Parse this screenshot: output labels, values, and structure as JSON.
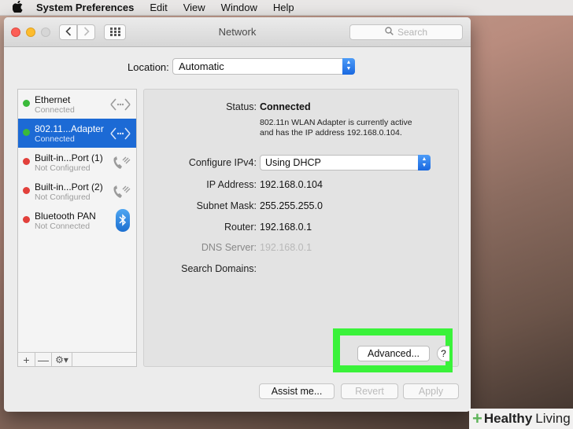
{
  "menubar": {
    "apple": "",
    "app": "System Preferences",
    "items": [
      "Edit",
      "View",
      "Window",
      "Help"
    ]
  },
  "window": {
    "title": "Network",
    "search_placeholder": "Search"
  },
  "location": {
    "label": "Location:",
    "value": "Automatic"
  },
  "services": [
    {
      "name": "Ethernet",
      "status": "Connected",
      "dot": "green",
      "icon": "ethernet-arrows-icon"
    },
    {
      "name": "802.11...Adapter",
      "status": "Connected",
      "dot": "green",
      "icon": "ethernet-arrows-icon",
      "selected": true
    },
    {
      "name": "Built-in...Port (1)",
      "status": "Not Configured",
      "dot": "red",
      "icon": "phone-modem-icon"
    },
    {
      "name": "Built-in...Port (2)",
      "status": "Not Configured",
      "dot": "red",
      "icon": "phone-modem-icon"
    },
    {
      "name": "Bluetooth PAN",
      "status": "Not Connected",
      "dot": "red",
      "icon": "bluetooth-icon"
    }
  ],
  "sidebar_tools": {
    "add": "+",
    "remove": "—",
    "gear": "⚙▾"
  },
  "detail": {
    "status_label": "Status:",
    "status_value": "Connected",
    "status_desc_1": "802.11n WLAN Adapter is currently active",
    "status_desc_2": "and has the IP address 192.168.0.104.",
    "configure_label": "Configure IPv4:",
    "configure_value": "Using DHCP",
    "ip_label": "IP Address:",
    "ip_value": "192.168.0.104",
    "subnet_label": "Subnet Mask:",
    "subnet_value": "255.255.255.0",
    "router_label": "Router:",
    "router_value": "192.168.0.1",
    "dns_label": "DNS Server:",
    "dns_value": "192.168.0.1",
    "domains_label": "Search Domains:"
  },
  "buttons": {
    "advanced": "Advanced...",
    "help": "?",
    "assist": "Assist me...",
    "revert": "Revert",
    "apply": "Apply"
  },
  "watermark": {
    "plus": "+",
    "word1": "Healthy",
    "word2": "Living"
  },
  "colors": {
    "highlight": "#3af23a",
    "selected": "#1c6ad5"
  }
}
